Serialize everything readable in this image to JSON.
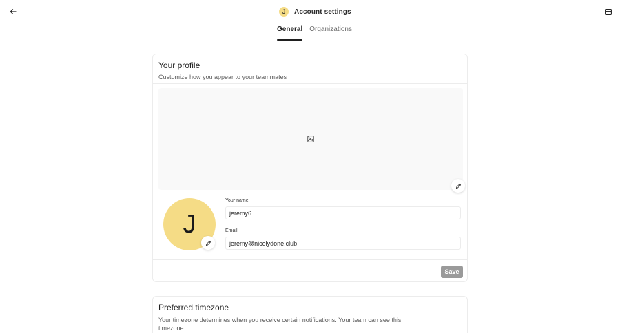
{
  "header": {
    "avatar_initial": "J",
    "title": "Account settings",
    "back_icon": "arrow-left-icon",
    "menu_icon": "sidebar-toggle-icon"
  },
  "tabs": [
    {
      "label": "General",
      "active": true
    },
    {
      "label": "Organizations",
      "active": false
    }
  ],
  "profile": {
    "title": "Your profile",
    "subtitle": "Customize how you appear to your teammates",
    "cover_icon": "image-placeholder-icon",
    "edit_icon": "pencil-icon",
    "avatar_initial": "J",
    "name_label": "Your name",
    "name_value": "jeremy6",
    "email_label": "Email",
    "email_value": "jeremy@nicelydone.club",
    "save_label": "Save"
  },
  "timezone": {
    "title": "Preferred timezone",
    "description": "Your timezone determines when you receive certain notifications. Your team can see this timezone."
  },
  "colors": {
    "avatar_bg": "#f5dc86",
    "save_bg": "#9a9a9a",
    "border": "#ececec"
  }
}
